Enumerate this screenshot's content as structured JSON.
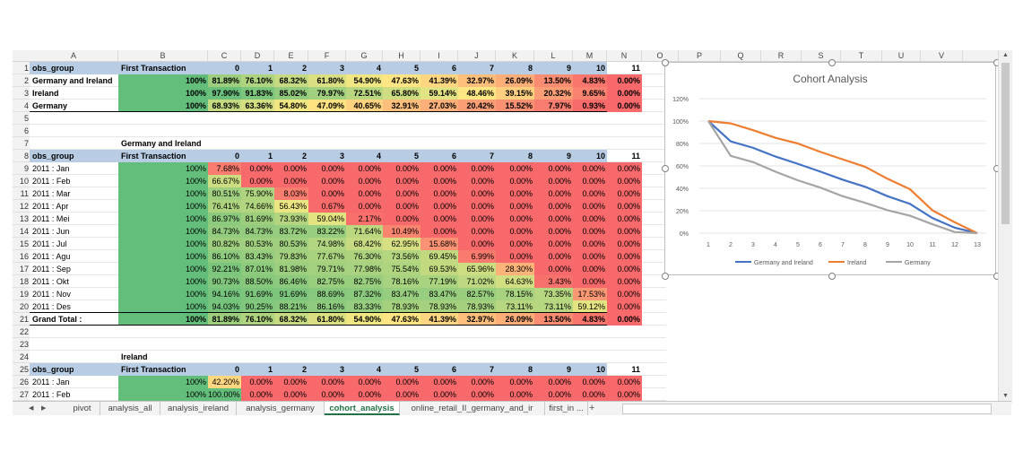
{
  "columns": [
    "A",
    "B",
    "C",
    "D",
    "E",
    "F",
    "G",
    "H",
    "I",
    "J",
    "K",
    "L",
    "M",
    "N",
    "O",
    "P",
    "Q",
    "R",
    "S",
    "T",
    "U",
    "V"
  ],
  "rows": [
    {
      "n": "1",
      "type": "header",
      "a": "obs_group",
      "b": "First Transaction",
      "vals": [
        "0",
        "1",
        "2",
        "3",
        "4",
        "5",
        "6",
        "7",
        "8",
        "9",
        "10",
        "11"
      ]
    },
    {
      "n": "2",
      "type": "data",
      "a": "Germany and Ireland",
      "vals": [
        "100%",
        "81.89%",
        "76.10%",
        "68.32%",
        "61.80%",
        "54.90%",
        "47.63%",
        "41.39%",
        "32.97%",
        "26.09%",
        "13.50%",
        "4.83%",
        "0.00%"
      ],
      "bold": true
    },
    {
      "n": "3",
      "type": "data",
      "a": "Ireland",
      "vals": [
        "100%",
        "97.90%",
        "91.83%",
        "85.02%",
        "79.97%",
        "72.51%",
        "65.80%",
        "59.14%",
        "48.46%",
        "39.15%",
        "20.32%",
        "9.65%",
        "0.00%"
      ],
      "bold": true
    },
    {
      "n": "4",
      "type": "data",
      "a": "Germany",
      "vals": [
        "100%",
        "68.93%",
        "63.36%",
        "54.80%",
        "47.09%",
        "40.65%",
        "32.91%",
        "27.03%",
        "20.42%",
        "15.52%",
        "7.97%",
        "0.93%",
        "0.00%"
      ],
      "bold": true
    },
    {
      "n": "5",
      "type": "empty"
    },
    {
      "n": "6",
      "type": "empty"
    },
    {
      "n": "7",
      "type": "title",
      "b": "Germany and Ireland"
    },
    {
      "n": "8",
      "type": "header",
      "a": "obs_group",
      "b": "First Transaction",
      "vals": [
        "0",
        "1",
        "2",
        "3",
        "4",
        "5",
        "6",
        "7",
        "8",
        "9",
        "10",
        "11"
      ]
    },
    {
      "n": "9",
      "type": "data",
      "a": "2011 : Jan",
      "vals": [
        "100%",
        "7.68%",
        "0.00%",
        "0.00%",
        "0.00%",
        "0.00%",
        "0.00%",
        "0.00%",
        "0.00%",
        "0.00%",
        "0.00%",
        "0.00%",
        "0.00%"
      ]
    },
    {
      "n": "10",
      "type": "data",
      "a": "2011 : Feb",
      "vals": [
        "100%",
        "66.67%",
        "0.00%",
        "0.00%",
        "0.00%",
        "0.00%",
        "0.00%",
        "0.00%",
        "0.00%",
        "0.00%",
        "0.00%",
        "0.00%",
        "0.00%"
      ]
    },
    {
      "n": "11",
      "type": "data",
      "a": "2011 : Mar",
      "vals": [
        "100%",
        "80.51%",
        "75.90%",
        "8.03%",
        "0.00%",
        "0.00%",
        "0.00%",
        "0.00%",
        "0.00%",
        "0.00%",
        "0.00%",
        "0.00%",
        "0.00%"
      ]
    },
    {
      "n": "12",
      "type": "data",
      "a": "2011 : Apr",
      "vals": [
        "100%",
        "76.41%",
        "74.66%",
        "56.43%",
        "0.67%",
        "0.00%",
        "0.00%",
        "0.00%",
        "0.00%",
        "0.00%",
        "0.00%",
        "0.00%",
        "0.00%"
      ]
    },
    {
      "n": "13",
      "type": "data",
      "a": "2011 : Mei",
      "vals": [
        "100%",
        "86.97%",
        "81.69%",
        "73.93%",
        "59.04%",
        "2.17%",
        "0.00%",
        "0.00%",
        "0.00%",
        "0.00%",
        "0.00%",
        "0.00%",
        "0.00%"
      ]
    },
    {
      "n": "14",
      "type": "data",
      "a": "2011 : Jun",
      "vals": [
        "100%",
        "84.73%",
        "84.73%",
        "83.72%",
        "83.22%",
        "71.64%",
        "10.49%",
        "0.00%",
        "0.00%",
        "0.00%",
        "0.00%",
        "0.00%",
        "0.00%"
      ]
    },
    {
      "n": "15",
      "type": "data",
      "a": "2011 : Jul",
      "vals": [
        "100%",
        "80.82%",
        "80.53%",
        "80.53%",
        "74.98%",
        "68.42%",
        "62.95%",
        "15.68%",
        "0.00%",
        "0.00%",
        "0.00%",
        "0.00%",
        "0.00%"
      ]
    },
    {
      "n": "16",
      "type": "data",
      "a": "2011 : Agu",
      "vals": [
        "100%",
        "86.10%",
        "83.43%",
        "79.83%",
        "77.67%",
        "76.30%",
        "73.56%",
        "69.45%",
        "6.99%",
        "0.00%",
        "0.00%",
        "0.00%",
        "0.00%"
      ]
    },
    {
      "n": "17",
      "type": "data",
      "a": "2011 : Sep",
      "vals": [
        "100%",
        "92.21%",
        "87.01%",
        "81.98%",
        "79.71%",
        "77.98%",
        "75.54%",
        "69.53%",
        "65.96%",
        "28.30%",
        "0.00%",
        "0.00%",
        "0.00%"
      ]
    },
    {
      "n": "18",
      "type": "data",
      "a": "2011 : Okt",
      "vals": [
        "100%",
        "90.73%",
        "88.50%",
        "86.46%",
        "82.75%",
        "82.75%",
        "78.16%",
        "77.19%",
        "71.02%",
        "64.63%",
        "3.43%",
        "0.00%",
        "0.00%"
      ]
    },
    {
      "n": "19",
      "type": "data",
      "a": "2011 : Nov",
      "vals": [
        "100%",
        "94.16%",
        "91.69%",
        "91.69%",
        "88.69%",
        "87.32%",
        "83.47%",
        "83.47%",
        "82.57%",
        "78.15%",
        "73.35%",
        "17.53%",
        "0.00%"
      ]
    },
    {
      "n": "20",
      "type": "data",
      "a": "2011 : Des",
      "vals": [
        "100%",
        "94.03%",
        "90.25%",
        "88.21%",
        "86.16%",
        "83.33%",
        "78.93%",
        "78.93%",
        "78.93%",
        "73.11%",
        "73.11%",
        "59.12%",
        "0.00%"
      ]
    },
    {
      "n": "21",
      "type": "data",
      "a": "Grand Total :",
      "vals": [
        "100%",
        "81.89%",
        "76.10%",
        "68.32%",
        "61.80%",
        "54.90%",
        "47.63%",
        "41.39%",
        "32.97%",
        "26.09%",
        "13.50%",
        "4.83%",
        "0.00%"
      ],
      "bold": true
    },
    {
      "n": "22",
      "type": "empty"
    },
    {
      "n": "23",
      "type": "empty"
    },
    {
      "n": "24",
      "type": "title",
      "b": "Ireland"
    },
    {
      "n": "25",
      "type": "header",
      "a": "obs_group",
      "b": "First Transaction",
      "vals": [
        "0",
        "1",
        "2",
        "3",
        "4",
        "5",
        "6",
        "7",
        "8",
        "9",
        "10",
        "11"
      ]
    },
    {
      "n": "26",
      "type": "data",
      "a": "2011 : Jan",
      "vals": [
        "100%",
        "42.20%",
        "0.00%",
        "0.00%",
        "0.00%",
        "0.00%",
        "0.00%",
        "0.00%",
        "0.00%",
        "0.00%",
        "0.00%",
        "0.00%",
        "0.00%"
      ]
    },
    {
      "n": "27",
      "type": "data",
      "a": "2011 : Feb",
      "vals": [
        "100%",
        "100.00%",
        "0.00%",
        "0.00%",
        "0.00%",
        "0.00%",
        "0.00%",
        "0.00%",
        "0.00%",
        "0.00%",
        "0.00%",
        "0.00%",
        "0.00%"
      ]
    }
  ],
  "chart_data": {
    "type": "line",
    "title": "Cohort Analysis",
    "x": [
      1,
      2,
      3,
      4,
      5,
      6,
      7,
      8,
      9,
      10,
      11,
      12,
      13
    ],
    "ylim": [
      0,
      120
    ],
    "yticks": [
      "0%",
      "20%",
      "40%",
      "60%",
      "80%",
      "100%",
      "120%"
    ],
    "legend_position": "bottom",
    "series": [
      {
        "name": "Germany and Ireland",
        "color": "#4472c4",
        "values": [
          100,
          81.89,
          76.1,
          68.32,
          61.8,
          54.9,
          47.63,
          41.39,
          32.97,
          26.09,
          13.5,
          4.83,
          0
        ]
      },
      {
        "name": "Ireland",
        "color": "#ed7d31",
        "values": [
          100,
          97.9,
          91.83,
          85.02,
          79.97,
          72.51,
          65.8,
          59.14,
          48.46,
          39.15,
          20.32,
          9.65,
          0
        ]
      },
      {
        "name": "Germany",
        "color": "#a5a5a5",
        "values": [
          100,
          68.93,
          63.36,
          54.8,
          47.09,
          40.65,
          32.91,
          27.03,
          20.42,
          15.52,
          7.97,
          0.93,
          0
        ]
      }
    ]
  },
  "sheet_tabs": [
    {
      "label": "pivot",
      "active": false
    },
    {
      "label": "analysis_all",
      "active": false
    },
    {
      "label": "analysis_ireland",
      "active": false
    },
    {
      "label": "analysis_germany",
      "active": false
    },
    {
      "label": "cohort_analysis",
      "active": true
    },
    {
      "label": "online_retail_II_germany_and_ir",
      "active": false
    },
    {
      "label": "first_in ...",
      "active": false
    }
  ],
  "add_sheet_symbol": "+"
}
